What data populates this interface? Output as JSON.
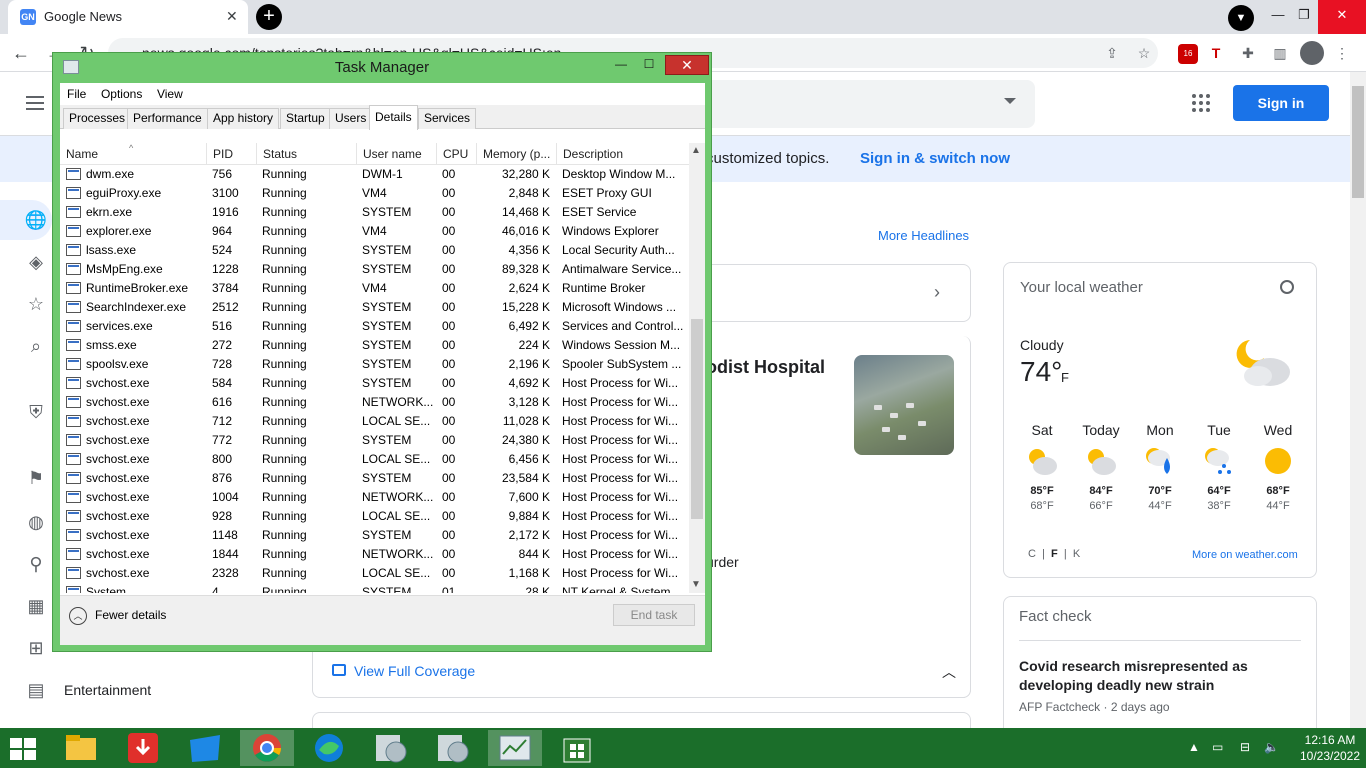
{
  "browser": {
    "tab_title": "Google News",
    "tab_favicon": "GN",
    "url": "news.google.com/topstories?tab=rn&hl=en-US&gl=US&ceid=US:en",
    "ext_badge": "16"
  },
  "page": {
    "signin_label": "Sign in",
    "banner_text": "customized topics.",
    "banner_link": "Sign in & switch now",
    "more_headlines": "More Headlines",
    "headline_fragment": "odist Hospital",
    "fragment2": "urder",
    "view_full_coverage": "View Full Coverage",
    "entertainment": "Entertainment"
  },
  "weather": {
    "title": "Your local weather",
    "condition": "Cloudy",
    "temp": "74°",
    "unit": "F",
    "days": [
      {
        "name": "Sat",
        "hi": "85°F",
        "lo": "68°F",
        "icon": "partly-cloudy-icon"
      },
      {
        "name": "Today",
        "hi": "84°F",
        "lo": "66°F",
        "icon": "partly-cloudy-icon"
      },
      {
        "name": "Mon",
        "hi": "70°F",
        "lo": "44°F",
        "icon": "rain-icon"
      },
      {
        "name": "Tue",
        "hi": "64°F",
        "lo": "38°F",
        "icon": "showers-icon"
      },
      {
        "name": "Wed",
        "hi": "68°F",
        "lo": "44°F",
        "icon": "sunny-icon"
      }
    ],
    "units": {
      "c": "C",
      "f": "F",
      "k": "K"
    },
    "more": "More on weather.com"
  },
  "factcheck": {
    "title": "Fact check",
    "headline": "Covid research misrepresented as developing deadly new strain",
    "source": "AFP Factcheck",
    "time": "2 days ago"
  },
  "taskmanager": {
    "title": "Task Manager",
    "menu": [
      "File",
      "Options",
      "View"
    ],
    "tabs": [
      "Processes",
      "Performance",
      "App history",
      "Startup",
      "Users",
      "Details",
      "Services"
    ],
    "active_tab": "Details",
    "columns": [
      "Name",
      "PID",
      "Status",
      "User name",
      "CPU",
      "Memory (p...",
      "Description"
    ],
    "rows": [
      [
        "dwm.exe",
        "756",
        "Running",
        "DWM-1",
        "00",
        "32,280 K",
        "Desktop Window M..."
      ],
      [
        "eguiProxy.exe",
        "3100",
        "Running",
        "VM4",
        "00",
        "2,848 K",
        "ESET Proxy GUI"
      ],
      [
        "ekrn.exe",
        "1916",
        "Running",
        "SYSTEM",
        "00",
        "14,468 K",
        "ESET Service"
      ],
      [
        "explorer.exe",
        "964",
        "Running",
        "VM4",
        "00",
        "46,016 K",
        "Windows Explorer"
      ],
      [
        "lsass.exe",
        "524",
        "Running",
        "SYSTEM",
        "00",
        "4,356 K",
        "Local Security Auth..."
      ],
      [
        "MsMpEng.exe",
        "1228",
        "Running",
        "SYSTEM",
        "00",
        "89,328 K",
        "Antimalware Service..."
      ],
      [
        "RuntimeBroker.exe",
        "3784",
        "Running",
        "VM4",
        "00",
        "2,624 K",
        "Runtime Broker"
      ],
      [
        "SearchIndexer.exe",
        "2512",
        "Running",
        "SYSTEM",
        "00",
        "15,228 K",
        "Microsoft Windows ..."
      ],
      [
        "services.exe",
        "516",
        "Running",
        "SYSTEM",
        "00",
        "6,492 K",
        "Services and Control..."
      ],
      [
        "smss.exe",
        "272",
        "Running",
        "SYSTEM",
        "00",
        "224 K",
        "Windows Session M..."
      ],
      [
        "spoolsv.exe",
        "728",
        "Running",
        "SYSTEM",
        "00",
        "2,196 K",
        "Spooler SubSystem ..."
      ],
      [
        "svchost.exe",
        "584",
        "Running",
        "SYSTEM",
        "00",
        "4,692 K",
        "Host Process for Wi..."
      ],
      [
        "svchost.exe",
        "616",
        "Running",
        "NETWORK...",
        "00",
        "3,128 K",
        "Host Process for Wi..."
      ],
      [
        "svchost.exe",
        "712",
        "Running",
        "LOCAL SE...",
        "00",
        "11,028 K",
        "Host Process for Wi..."
      ],
      [
        "svchost.exe",
        "772",
        "Running",
        "SYSTEM",
        "00",
        "24,380 K",
        "Host Process for Wi..."
      ],
      [
        "svchost.exe",
        "800",
        "Running",
        "LOCAL SE...",
        "00",
        "6,456 K",
        "Host Process for Wi..."
      ],
      [
        "svchost.exe",
        "876",
        "Running",
        "SYSTEM",
        "00",
        "23,584 K",
        "Host Process for Wi..."
      ],
      [
        "svchost.exe",
        "1004",
        "Running",
        "NETWORK...",
        "00",
        "7,600 K",
        "Host Process for Wi..."
      ],
      [
        "svchost.exe",
        "928",
        "Running",
        "LOCAL SE...",
        "00",
        "9,884 K",
        "Host Process for Wi..."
      ],
      [
        "svchost.exe",
        "1148",
        "Running",
        "SYSTEM",
        "00",
        "2,172 K",
        "Host Process for Wi..."
      ],
      [
        "svchost.exe",
        "1844",
        "Running",
        "NETWORK...",
        "00",
        "844 K",
        "Host Process for Wi..."
      ],
      [
        "svchost.exe",
        "2328",
        "Running",
        "LOCAL SE...",
        "00",
        "1,168 K",
        "Host Process for Wi..."
      ],
      [
        "System",
        "4",
        "Running",
        "SYSTEM",
        "01",
        "28 K",
        "NT Kernel & System"
      ]
    ],
    "fewer_details": "Fewer details",
    "end_task": "End task"
  },
  "taskbar": {
    "time": "12:16 AM",
    "date": "10/23/2022"
  }
}
